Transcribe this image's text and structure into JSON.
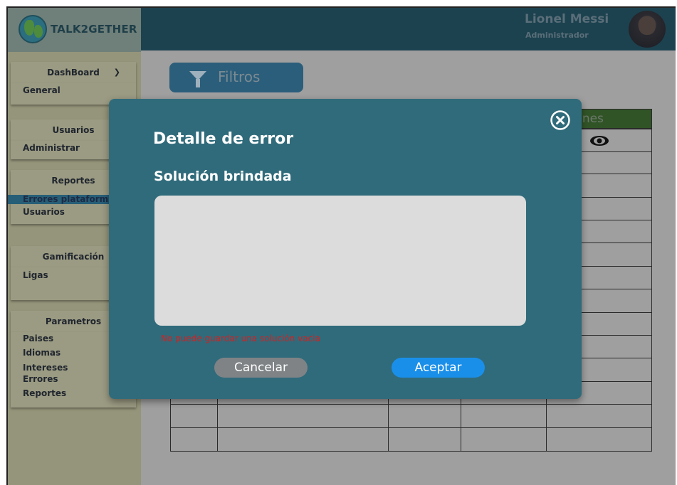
{
  "brand": {
    "name": "TALK2GETHER"
  },
  "user": {
    "name": "Lionel Messi",
    "role": "Administrador"
  },
  "sidebar": {
    "sections": [
      {
        "title": "DashBoard",
        "items": [
          "General"
        ]
      },
      {
        "title": "Usuarios",
        "items": [
          "Administrar"
        ]
      },
      {
        "title": "Reportes",
        "items": [
          "Errores plataform",
          "Usuarios"
        ]
      },
      {
        "title": "Gamificación",
        "items": [
          "Ligas"
        ]
      },
      {
        "title": "Parametros",
        "items": [
          "Paises",
          "Idiomas",
          "Intereses",
          "Errores",
          "Reportes"
        ]
      }
    ],
    "active_item": "Errores plataform"
  },
  "filter": {
    "label": "Filtros"
  },
  "table": {
    "header_actions": "cciones"
  },
  "modal": {
    "title": "Detalle de error",
    "subtitle": "Solución brindada",
    "textarea_value": "",
    "error_message": "No puede guardar una solución vacia",
    "cancel_label": "Cancelar",
    "accept_label": "Aceptar"
  },
  "colors": {
    "modal_bg": "#306b7b",
    "accept": "#1a8fea",
    "error": "#d71f1f"
  }
}
